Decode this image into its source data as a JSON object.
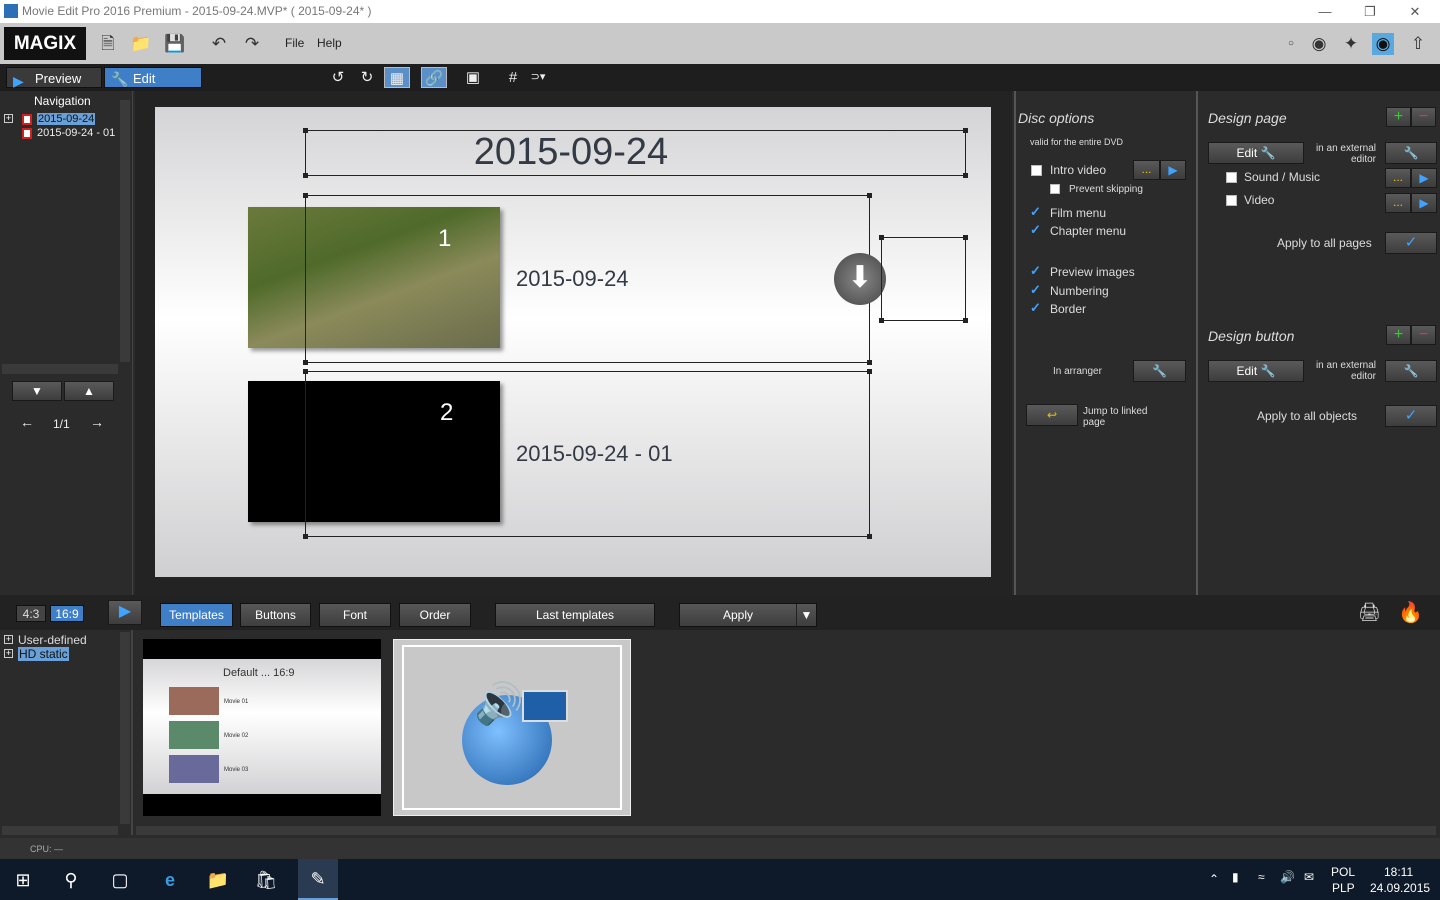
{
  "titlebar": {
    "title": "Movie Edit Pro 2016 Premium - 2015-09-24.MVP* ( 2015-09-24* )"
  },
  "logo": "MAGIX",
  "menu": {
    "file": "File",
    "help": "Help"
  },
  "modes": {
    "preview": "Preview",
    "edit": "Edit"
  },
  "navigation": {
    "title": "Navigation",
    "items": [
      "2015-09-24",
      "2015-09-24 - 01"
    ],
    "page": "1/1"
  },
  "canvas": {
    "title": "2015-09-24",
    "chapters": [
      {
        "number": "1",
        "label": "2015-09-24"
      },
      {
        "number": "2",
        "label": "2015-09-24 - 01"
      }
    ]
  },
  "disc_options": {
    "title": "Disc options",
    "subtitle": "valid for the entire DVD",
    "intro_video": "Intro video",
    "prevent_skipping": "Prevent skipping",
    "film_menu": "Film menu",
    "chapter_menu": "Chapter menu",
    "preview_images": "Preview images",
    "numbering": "Numbering",
    "border": "Border",
    "in_arranger": "In arranger",
    "jump_linked": "Jump to linked page",
    "dots": "..."
  },
  "design_page": {
    "title": "Design page",
    "edit": "Edit",
    "external": "in an external editor",
    "sound_music": "Sound / Music",
    "video": "Video",
    "apply_all_pages": "Apply to all pages"
  },
  "design_button": {
    "title": "Design button",
    "edit": "Edit",
    "external": "in an external editor",
    "apply_all_objects": "Apply to all objects"
  },
  "bottom": {
    "ratio_43": "4:3",
    "ratio_169": "16:9",
    "tabs": [
      "Templates",
      "Buttons",
      "Font",
      "Order"
    ],
    "last_templates": "Last templates",
    "apply": "Apply"
  },
  "templates": {
    "tree": [
      "User-defined",
      "HD static"
    ],
    "thumb1": {
      "title": "Default ... 16:9",
      "movies": [
        "Movie 01",
        "Movie 02",
        "Movie 03"
      ]
    }
  },
  "status": {
    "cpu": "CPU: —"
  },
  "taskbar": {
    "lang1": "POL",
    "lang2": "PLP",
    "time": "18:11",
    "date": "24.09.2015"
  },
  "colors": {
    "accent": "#3f8fd8",
    "selection": "#6aa0d8"
  }
}
